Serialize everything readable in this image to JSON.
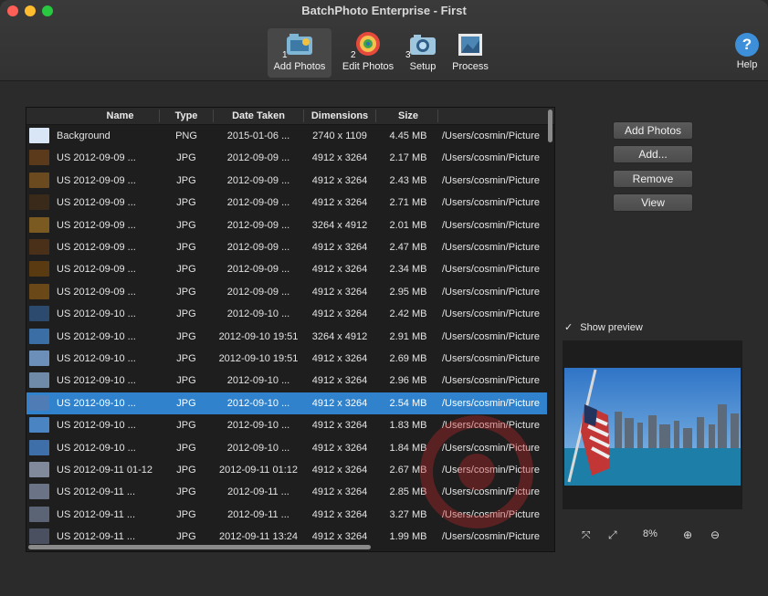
{
  "window": {
    "title": "BatchPhoto Enterprise - First"
  },
  "toolbar": {
    "items": [
      {
        "label": "Add Photos",
        "num": "1",
        "icon": "add-photos-icon"
      },
      {
        "label": "Edit Photos",
        "num": "2",
        "icon": "edit-photos-icon"
      },
      {
        "label": "Setup",
        "num": "3",
        "icon": "setup-icon"
      },
      {
        "label": "Process",
        "num": "",
        "icon": "process-icon"
      }
    ],
    "help_label": "Help",
    "help_glyph": "?"
  },
  "table": {
    "headers": [
      "Name",
      "Type",
      "Date Taken",
      "Dimensions",
      "Size"
    ],
    "selected_index": 13,
    "rows": [
      [
        "Background",
        "PNG",
        "2015-01-06 ...",
        "2740 x 1109",
        "4.45 MB",
        "/Users/cosmin/Picture"
      ],
      [
        "US 2012-09-09 ...",
        "JPG",
        "2012-09-09 ...",
        "4912 x 3264",
        "2.17 MB",
        "/Users/cosmin/Picture"
      ],
      [
        "US 2012-09-09 ...",
        "JPG",
        "2012-09-09 ...",
        "4912 x 3264",
        "2.43 MB",
        "/Users/cosmin/Picture"
      ],
      [
        "US 2012-09-09 ...",
        "JPG",
        "2012-09-09 ...",
        "4912 x 3264",
        "2.71 MB",
        "/Users/cosmin/Picture"
      ],
      [
        "US 2012-09-09 ...",
        "JPG",
        "2012-09-09 ...",
        "3264 x 4912",
        "2.01 MB",
        "/Users/cosmin/Picture"
      ],
      [
        "US 2012-09-09 ...",
        "JPG",
        "2012-09-09 ...",
        "4912 x 3264",
        "2.47 MB",
        "/Users/cosmin/Picture"
      ],
      [
        "US 2012-09-09 ...",
        "JPG",
        "2012-09-09 ...",
        "4912 x 3264",
        "2.34 MB",
        "/Users/cosmin/Picture"
      ],
      [
        "US 2012-09-09 ...",
        "JPG",
        "2012-09-09 ...",
        "4912 x 3264",
        "2.95 MB",
        "/Users/cosmin/Picture"
      ],
      [
        "US 2012-09-10 ...",
        "JPG",
        "2012-09-10 ...",
        "4912 x 3264",
        "2.42 MB",
        "/Users/cosmin/Picture"
      ],
      [
        "US 2012-09-10 ...",
        "JPG",
        "2012-09-10 19:51",
        "3264 x 4912",
        "2.91 MB",
        "/Users/cosmin/Picture"
      ],
      [
        "US 2012-09-10 ...",
        "JPG",
        "2012-09-10 19:51",
        "4912 x 3264",
        "2.69 MB",
        "/Users/cosmin/Picture"
      ],
      [
        "US 2012-09-10 ...",
        "JPG",
        "2012-09-10 ...",
        "4912 x 3264",
        "2.96 MB",
        "/Users/cosmin/Picture"
      ],
      [
        "US 2012-09-10 ...",
        "JPG",
        "2012-09-10 ...",
        "4912 x 3264",
        "2.54 MB",
        "/Users/cosmin/Picture"
      ],
      [
        "US 2012-09-10 ...",
        "JPG",
        "2012-09-10 ...",
        "4912 x 3264",
        "1.83 MB",
        "/Users/cosmin/Picture"
      ],
      [
        "US 2012-09-10 ...",
        "JPG",
        "2012-09-10 ...",
        "4912 x 3264",
        "1.84 MB",
        "/Users/cosmin/Picture"
      ],
      [
        "US 2012-09-11 01-12",
        "JPG",
        "2012-09-11 01:12",
        "4912 x 3264",
        "2.67 MB",
        "/Users/cosmin/Picture"
      ],
      [
        "US 2012-09-11 ...",
        "JPG",
        "2012-09-11 ...",
        "4912 x 3264",
        "2.85 MB",
        "/Users/cosmin/Picture"
      ],
      [
        "US 2012-09-11 ...",
        "JPG",
        "2012-09-11 ...",
        "4912 x 3264",
        "3.27 MB",
        "/Users/cosmin/Picture"
      ],
      [
        "US 2012-09-11 ...",
        "JPG",
        "2012-09-11 13:24",
        "4912 x 3264",
        "1.99 MB",
        "/Users/cosmin/Picture"
      ]
    ]
  },
  "side_buttons": [
    "Add Photos",
    "Add...",
    "Remove",
    "View"
  ],
  "preview": {
    "checkbox_label": "Show preview",
    "checkmark": "✓",
    "zoom": "8%"
  },
  "controls": {
    "fit_glyph": "⤧",
    "actual_glyph": "⤢",
    "zoom_in_glyph": "⊕",
    "zoom_out_glyph": "⊖"
  },
  "colors": {
    "selection": "#2f82cb"
  }
}
